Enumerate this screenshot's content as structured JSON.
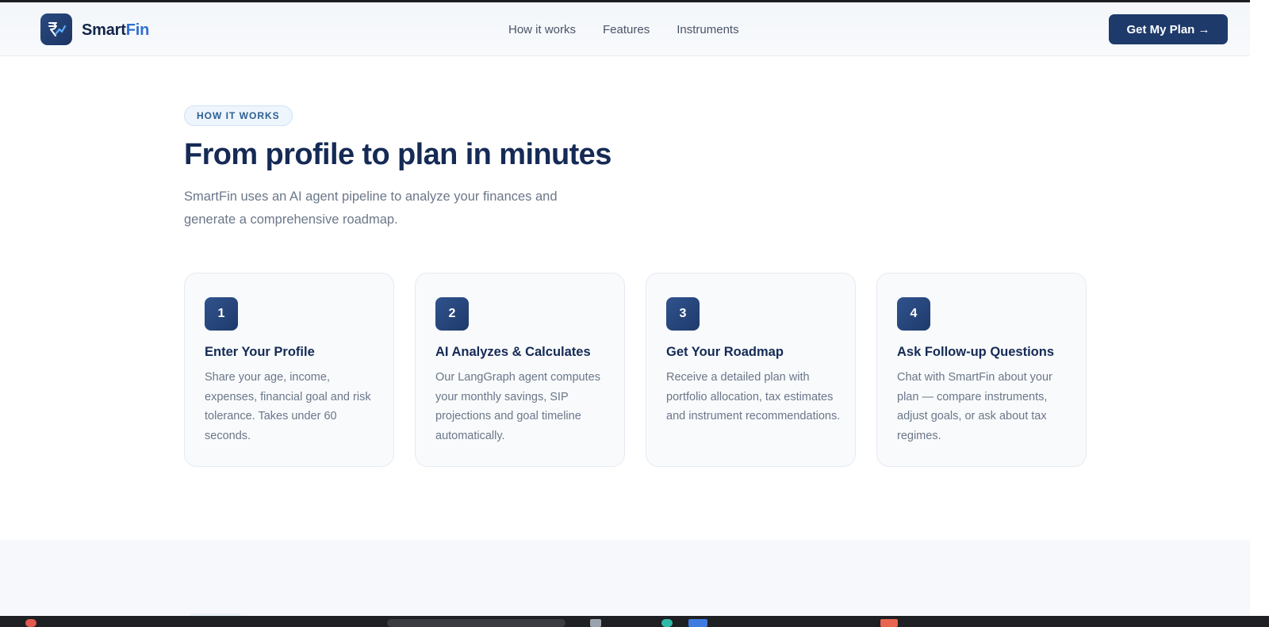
{
  "brand": {
    "name_primary": "Smart",
    "name_accent": "Fin"
  },
  "nav": [
    {
      "label": "How it works"
    },
    {
      "label": "Features"
    },
    {
      "label": "Instruments"
    }
  ],
  "header": {
    "cta_label": "Get My Plan →"
  },
  "hero": {
    "pill": "HOW IT WORKS",
    "title": "From profile to plan in minutes",
    "subtitle": "SmartFin uses an AI agent pipeline to analyze your finances and generate a comprehensive roadmap."
  },
  "steps": [
    {
      "number": "1",
      "title": "Enter Your Profile",
      "description": "Share your age, income, expenses, financial goal and risk tolerance. Takes under 60 seconds."
    },
    {
      "number": "2",
      "title": "AI Analyzes & Calculates",
      "description": "Our LangGraph agent computes your monthly savings, SIP projections and goal timeline automatically."
    },
    {
      "number": "3",
      "title": "Get Your Roadmap",
      "description": "Receive a detailed plan with portfolio allocation, tax estimates and instrument recommendations."
    },
    {
      "number": "4",
      "title": "Ask Follow-up Questions",
      "description": "Chat with SmartFin about your plan — compare instruments, adjust goals, or ask about tax regimes."
    }
  ],
  "colors": {
    "brand_navy": "#1e3a6b",
    "accent_blue": "#2f6fcf",
    "text_muted": "#6b7789"
  },
  "icons": {
    "logo": "rupee-chart-icon"
  }
}
